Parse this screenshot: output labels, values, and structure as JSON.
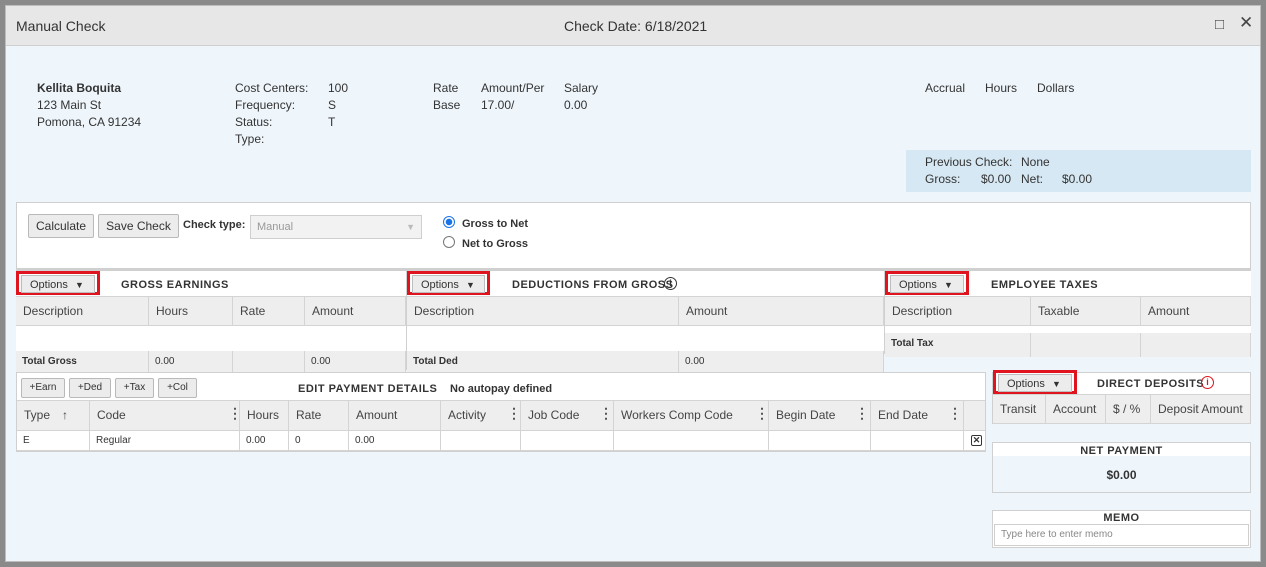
{
  "window": {
    "title": "Manual Check",
    "check_date": "Check Date: 6/18/2021"
  },
  "employee": {
    "name": "Kellita Boquita",
    "address1": "123 Main St",
    "address2": "Pomona, CA 91234"
  },
  "meta": {
    "cost_centers_label": "Cost Centers:",
    "cost_centers_value": "100",
    "frequency_label": "Frequency:",
    "frequency_value": "S",
    "status_label": "Status:",
    "status_value": "T",
    "type_label": "Type:"
  },
  "rate": {
    "rate_label": "Rate",
    "base_label": "Base",
    "amount_per_label": "Amount/Per",
    "amount_per_value": "17.00/",
    "salary_label": "Salary",
    "salary_value": "0.00"
  },
  "accrual": {
    "accrual_label": "Accrual",
    "hours_label": "Hours",
    "dollars_label": "Dollars"
  },
  "previous_check": {
    "label": "Previous Check:",
    "value": "None",
    "gross_label": "Gross:",
    "gross_value": "$0.00",
    "net_label": "Net:",
    "net_value": "$0.00"
  },
  "toolbar": {
    "calculate": "Calculate",
    "save_check": "Save Check",
    "check_type_label": "Check type:",
    "check_type_value": "Manual",
    "gross_to_net": "Gross to Net",
    "net_to_gross": "Net to Gross"
  },
  "options_label": "Options",
  "gross_earnings": {
    "title": "GROSS EARNINGS",
    "columns": [
      "Description",
      "Hours",
      "Rate",
      "Amount"
    ],
    "total_label": "Total Gross",
    "total_hours": "0.00",
    "total_amount": "0.00"
  },
  "deductions": {
    "title": "DEDUCTIONS FROM GROSS",
    "columns": [
      "Description",
      "Amount"
    ],
    "total_label": "Total Ded",
    "total_amount": "0.00"
  },
  "taxes": {
    "title": "EMPLOYEE TAXES",
    "columns": [
      "Description",
      "Taxable",
      "Amount"
    ],
    "total_label": "Total Tax"
  },
  "payment": {
    "buttons": [
      "+Earn",
      "+Ded",
      "+Tax",
      "+Col"
    ],
    "title": "EDIT PAYMENT DETAILS",
    "autopay": "No autopay defined",
    "columns": [
      "Type",
      "Code",
      "Hours",
      "Rate",
      "Amount",
      "Activity",
      "Job Code",
      "Workers Comp Code",
      "Begin Date",
      "End Date"
    ],
    "row": [
      "E",
      "Regular",
      "0.00",
      "0",
      "0.00",
      "",
      "",
      "",
      "",
      ""
    ]
  },
  "direct_deposits": {
    "title": "DIRECT DEPOSITS",
    "columns": [
      "Transit",
      "Account",
      "$ / %",
      "Deposit Amount"
    ]
  },
  "net_payment": {
    "title": "NET PAYMENT",
    "value": "$0.00"
  },
  "memo": {
    "title": "MEMO",
    "placeholder": "Type here to enter memo"
  },
  "colors": {
    "highlight": "#e0141e",
    "accent": "#1a73e8",
    "info_red": "#e0141e"
  }
}
